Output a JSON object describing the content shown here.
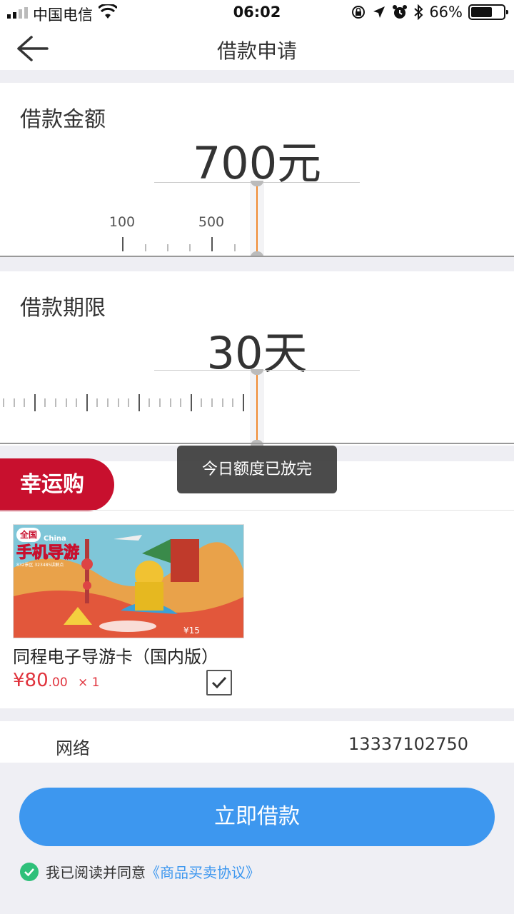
{
  "status_bar": {
    "carrier": "中国电信",
    "time": "06:02",
    "battery": "66%"
  },
  "nav": {
    "title": "借款申请"
  },
  "amount": {
    "label": "借款金额",
    "value": "700元",
    "ruler_labels": [
      "100",
      "500"
    ]
  },
  "term": {
    "label": "借款期限",
    "value": "30天"
  },
  "toast": "今日额度已放完",
  "lucky": {
    "tag": "幸运购",
    "product_name": "同程电子导游卡（国内版）",
    "price_main": "¥80",
    "price_decimal": ".00",
    "quantity": "× 1",
    "image_text": {
      "badge": "全国",
      "china": "China",
      "title": "手机导游",
      "sub": "832景区 323485讲解点",
      "tag": "¥15"
    }
  },
  "info": {
    "network": "网络",
    "phone": "13337102750"
  },
  "cta": {
    "label": "立即借款"
  },
  "agreement": {
    "prefix": "我已阅读并同意",
    "link": "《商品买卖协议》"
  },
  "colors": {
    "brand_blue": "#3d97ef",
    "lucky_red": "#c8102e",
    "price_red": "#e0323c",
    "indicator_orange": "#f08a30"
  }
}
